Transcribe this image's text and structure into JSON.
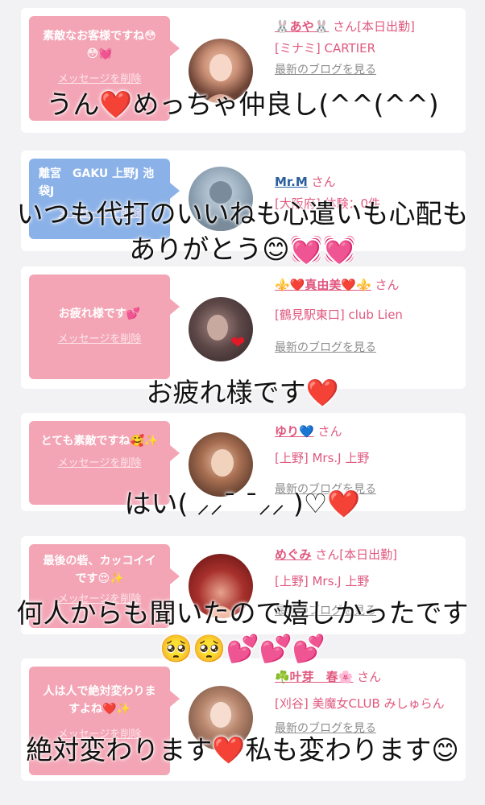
{
  "cards": [
    {
      "message": "素敵なお客様ですね😳😳💓",
      "delete_label": "メッセージを削除",
      "name": "🐰あや🐰",
      "san": "さん[本日出勤]",
      "shop": "[ミナミ] CARTIER",
      "blog": "最新のブログを見る",
      "overlay": "うん❤️めっちゃ仲良し(^^(^^)"
    },
    {
      "message": "離宮　GAKU 上野J 池袋J",
      "delete_label": "メッセージを削除",
      "name": "Mr.M",
      "san": "さん",
      "shop": "[大阪府] 体験：0件",
      "overlay": "いつも代打のいいねも心遣いも心配もありがとう😊💓💓"
    },
    {
      "message": "お疲れ様です💕",
      "delete_label": "メッセージを削除",
      "name": "⚜️❤️真由美❤️⚜️",
      "san": "さん",
      "shop": "[鶴見駅東口] club Lien",
      "blog": "最新のブログを見る",
      "overlay": "お疲れ様です❤️"
    },
    {
      "message": "とても素敵ですね🥰✨",
      "delete_label": "メッセージを削除",
      "name": "ゆり💙",
      "san": "さん",
      "shop": "[上野] Mrs.J 上野",
      "blog": "最新のブログを見る",
      "overlay": "はい( ⸝⸝¯ ¯⸝⸝ )♡❤️"
    },
    {
      "message": "最後の砦、カッコイイです😍✨",
      "delete_label": "メッセージを削除",
      "name": "めぐみ",
      "san": "さん[本日出勤]",
      "shop": "[上野] Mrs.J 上野",
      "blog": "最新のブログを見る",
      "overlay": "何人からも聞いたので嬉しかったです🥺🥺💕💕💕"
    },
    {
      "message": "人は人で絶対変わりますよね❤️✨",
      "delete_label": "メッセージを削除",
      "name": "☘️叶芽　春🌸",
      "san": "さん",
      "shop": "[刈谷] 美魔女CLUB みしゅらん",
      "blog": "最新のブログを見る",
      "overlay": "絶対変わります❤️私も変わります😊"
    }
  ],
  "colors": {
    "pink_bubble": "#f3a5b5",
    "blue_bubble": "#8bb2e8",
    "name_pink": "#e0587f",
    "name_blue": "#2a5f9e"
  }
}
